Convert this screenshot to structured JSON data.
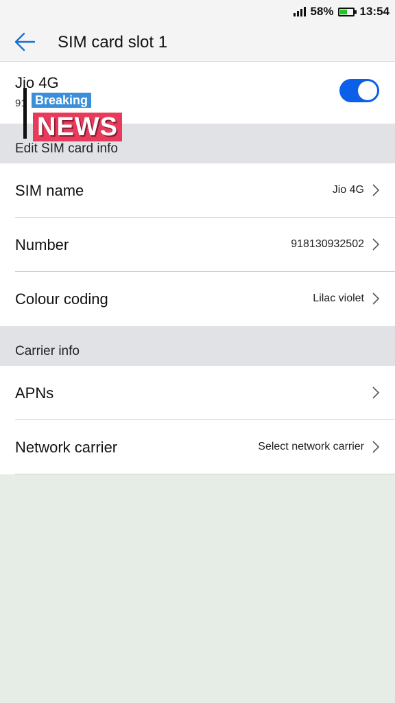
{
  "status_bar": {
    "battery_percent": "58%",
    "battery_level": 0.58,
    "time": "13:54",
    "signal_icon": "signal-icon",
    "battery_icon": "battery-icon"
  },
  "header": {
    "title": "SIM card slot 1",
    "back_icon": "back-arrow-icon"
  },
  "sim_card": {
    "name": "Jio 4G",
    "number_partial": "91",
    "enabled": true,
    "accent_color": "#0b5fe8"
  },
  "overlay_logo": {
    "line1": "Breaking",
    "line2": "NEWS"
  },
  "sections": {
    "edit_sim": {
      "title": "Edit SIM card info",
      "rows": [
        {
          "label": "SIM name",
          "value": "Jio 4G"
        },
        {
          "label": "Number",
          "value": "918130932502"
        },
        {
          "label": "Colour coding",
          "value": "Lilac violet"
        }
      ]
    },
    "carrier": {
      "title": "Carrier info",
      "rows": [
        {
          "label": "APNs",
          "value": ""
        },
        {
          "label": "Network carrier",
          "value": "Select network carrier"
        }
      ]
    }
  }
}
